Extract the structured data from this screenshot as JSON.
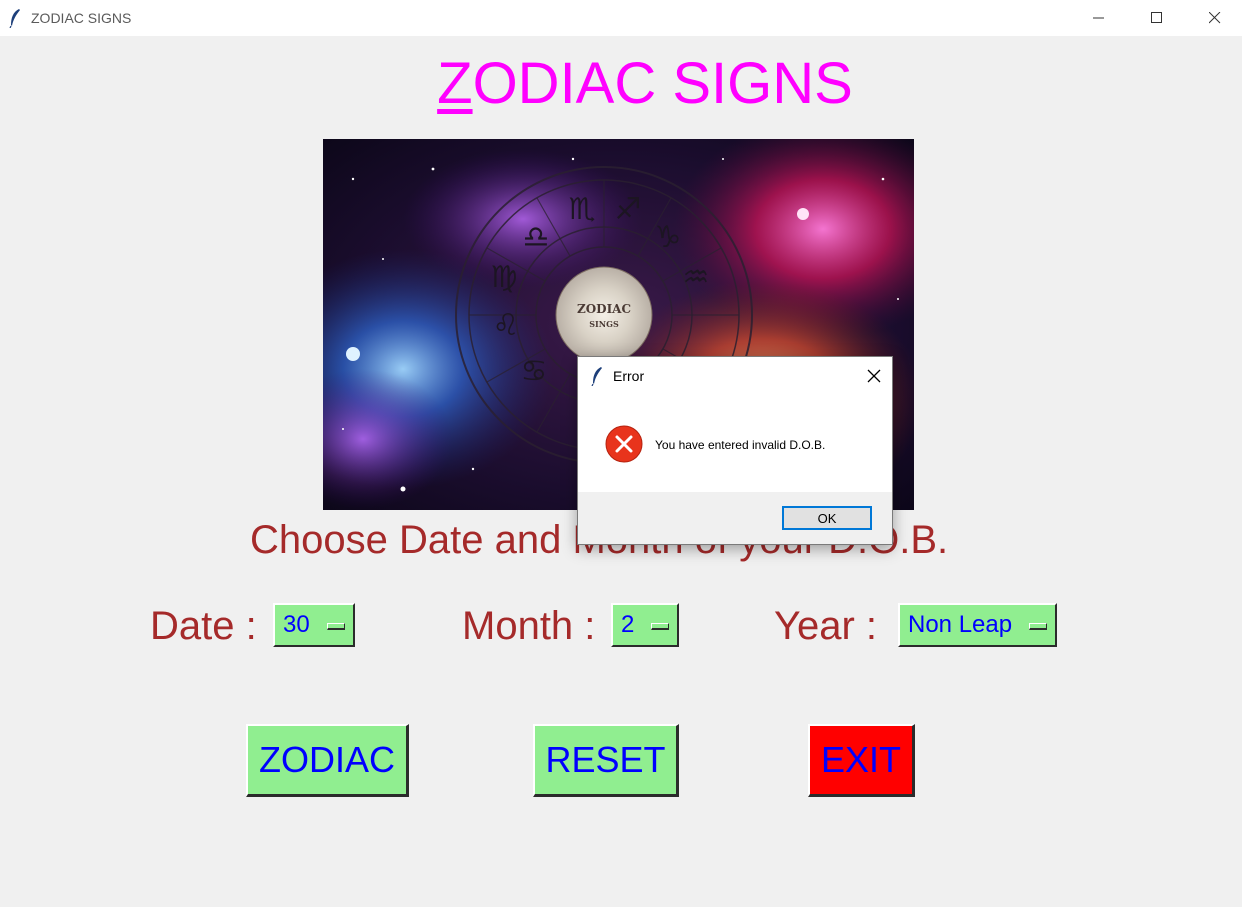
{
  "window": {
    "title": "ZODIAC SIGNS",
    "controls": [
      "minimize",
      "maximize",
      "close"
    ]
  },
  "header": {
    "title_first": "Z",
    "title_rest": "ODIAC SIGNS",
    "color": "#ff00ff"
  },
  "banner": {
    "caption_line1": "ZODIAC",
    "caption_line2": "SINGS"
  },
  "prompt": "Choose Date and Month of your D.O.B.",
  "fields": {
    "date_label": "Date :",
    "date_value": "30",
    "month_label": "Month :",
    "month_value": "2",
    "year_label": "Year :",
    "year_value": "Non Leap"
  },
  "buttons": {
    "zodiac": "ZODIAC",
    "reset": "RESET",
    "exit": "EXIT"
  },
  "dialog": {
    "title": "Error",
    "message": "You have entered invalid D.O.B.",
    "ok": "OK"
  },
  "colors": {
    "background": "#f0f0f0",
    "label": "#a52a2a",
    "button_bg": "#90ee90",
    "exit_bg": "#ff0000",
    "button_text": "#0000ff"
  },
  "icons": {
    "app": "feather-icon",
    "error": "error-x-icon"
  }
}
